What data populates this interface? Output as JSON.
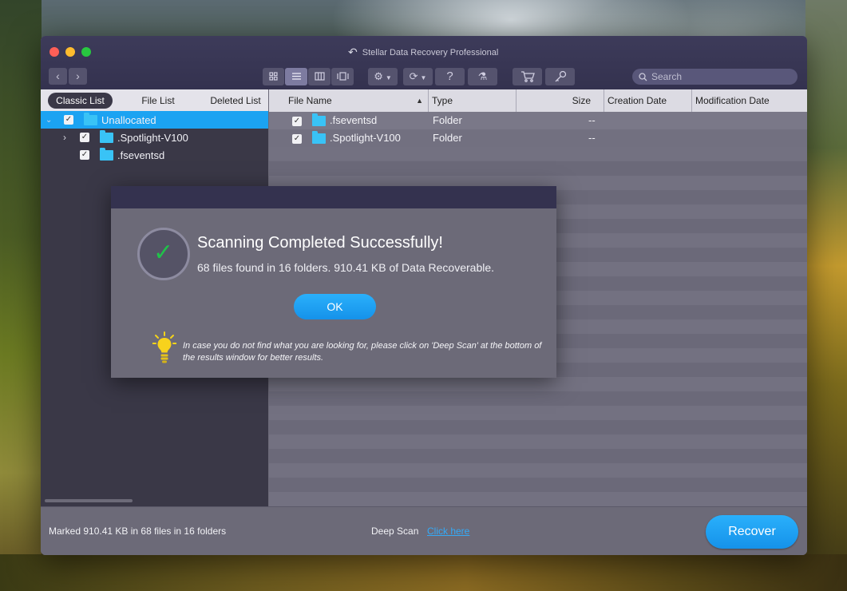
{
  "window": {
    "title": "Stellar Data Recovery Professional"
  },
  "toolbar": {
    "search_placeholder": "Search"
  },
  "left_panel": {
    "tabs": [
      "Classic List",
      "File List",
      "Deleted List"
    ],
    "tree": [
      {
        "label": "Unallocated",
        "selected": true
      },
      {
        "label": ".Spotlight-V100",
        "selected": false
      },
      {
        "label": ".fseventsd",
        "selected": false
      }
    ]
  },
  "file_table": {
    "columns": [
      "File Name",
      "Type",
      "Size",
      "Creation Date",
      "Modification Date"
    ],
    "rows": [
      {
        "name": ".fseventsd",
        "type": "Folder",
        "size": "--"
      },
      {
        "name": ".Spotlight-V100",
        "type": "Folder",
        "size": "--"
      }
    ]
  },
  "status": {
    "marked": "Marked 910.41 KB in 68 files in 16 folders",
    "deep_scan_label": "Deep Scan",
    "deep_scan_link": "Click here",
    "recover_label": "Recover"
  },
  "modal": {
    "title": "Scanning Completed Successfully!",
    "subtitle": "68 files found in 16 folders. 910.41 KB of Data Recoverable.",
    "ok_label": "OK",
    "tip": "In case you do not find what you are looking for, please click on 'Deep Scan' at the bottom of the results window for better results."
  },
  "colors": {
    "accent": "#1ba3f2",
    "success": "#20c24a",
    "link": "#34aaf7"
  }
}
